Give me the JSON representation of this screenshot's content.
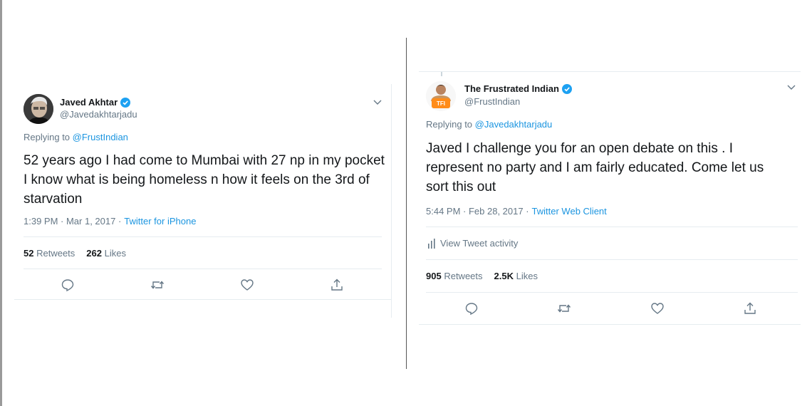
{
  "tweet_left": {
    "name": "Javed Akhtar",
    "handle": "@Javedakhtarjadu",
    "replying_prefix": "Replying to",
    "replying_to": "@FrustIndian",
    "text": "52 years ago I had come to Mumbai with 27 np in my pocket I know what is being homeless n how it feels on the 3rd of starvation",
    "timestamp": "1:39 PM · Mar 1, 2017 ·",
    "source": "Twitter for iPhone",
    "retweets_count": "52",
    "retweets_label": "Retweets",
    "likes_count": "262",
    "likes_label": "Likes"
  },
  "tweet_right": {
    "name": "The Frustrated Indian",
    "handle": "@FrustIndian",
    "avatar_text": "TFI",
    "replying_prefix": "Replying to",
    "replying_to": "@Javedakhtarjadu",
    "text": "Javed I challenge you for an open debate on this . I represent no party and I am fairly educated. Come let us sort this out",
    "timestamp": "5:44 PM · Feb 28, 2017 ·",
    "source": "Twitter Web Client",
    "activity_label": "View Tweet activity",
    "retweets_count": "905",
    "retweets_label": "Retweets",
    "likes_count": "2.5K",
    "likes_label": "Likes"
  },
  "icons": {
    "verified": "verified-badge-icon",
    "more": "chevron-down-icon",
    "reply": "reply-icon",
    "retweet": "retweet-icon",
    "like": "heart-icon",
    "share": "share-icon",
    "activity": "bar-chart-icon"
  },
  "colors": {
    "link": "#1b95e0",
    "muted": "#657786",
    "text": "#14171a",
    "verified": "#1da1f2",
    "border": "#e6ecf0"
  }
}
